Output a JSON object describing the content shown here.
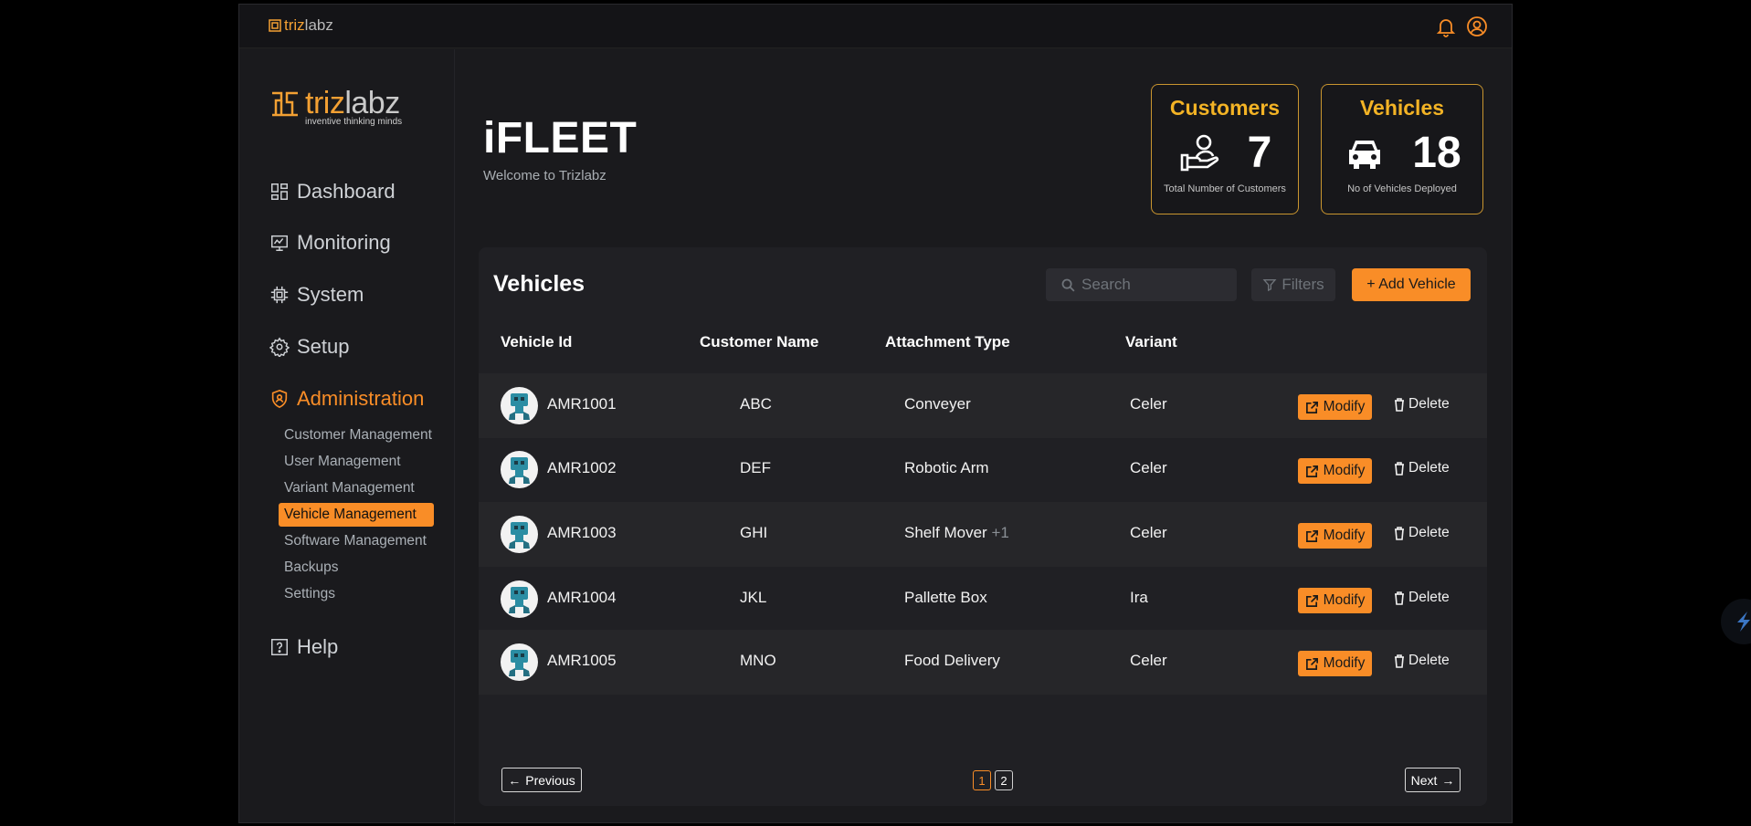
{
  "brand": {
    "part1": "triz",
    "part2": "labz",
    "tagline": "inventive thinking minds",
    "accent_color": "#f98d27"
  },
  "header": {
    "bell_icon": "bell-icon",
    "profile_icon": "user-circle-icon"
  },
  "sidebar": {
    "nav": [
      {
        "label": "Dashboard",
        "icon": "grid-icon"
      },
      {
        "label": "Monitoring",
        "icon": "monitor-icon"
      },
      {
        "label": "System",
        "icon": "chip-icon"
      },
      {
        "label": "Setup",
        "icon": "gear-icon"
      },
      {
        "label": "Administration",
        "icon": "shield-user-icon"
      }
    ],
    "admin_sub": [
      "Customer Management",
      "User Management",
      "Variant Management",
      "Vehicle Management",
      "Software Management",
      "Backups",
      "Settings"
    ],
    "help": {
      "label": "Help",
      "icon": "help-icon"
    }
  },
  "page": {
    "title": "iFLEET",
    "subtitle": "Welcome to Trizlabz"
  },
  "stats": {
    "customers": {
      "title": "Customers",
      "value": "7",
      "caption": "Total Number of Customers"
    },
    "vehicles": {
      "title": "Vehicles",
      "value": "18",
      "caption": "No of Vehicles Deployed"
    }
  },
  "panel": {
    "title": "Vehicles",
    "search_placeholder": "Search",
    "filters_label": "Filters",
    "add_label": "+ Add Vehicle",
    "columns": [
      "Vehicle Id",
      "Customer Name",
      "Attachment Type",
      "Variant"
    ],
    "modify_label": "Modify",
    "delete_label": "Delete",
    "rows": [
      {
        "id": "AMR1001",
        "customer": "ABC",
        "attachment": "Conveyer",
        "extra": "",
        "variant": "Celer"
      },
      {
        "id": "AMR1002",
        "customer": "DEF",
        "attachment": "Robotic Arm",
        "extra": "",
        "variant": "Celer"
      },
      {
        "id": "AMR1003",
        "customer": "GHI",
        "attachment": "Shelf Mover",
        "extra": "+1",
        "variant": "Celer"
      },
      {
        "id": "AMR1004",
        "customer": "JKL",
        "attachment": "Pallette Box",
        "extra": "",
        "variant": "Ira"
      },
      {
        "id": "AMR1005",
        "customer": "MNO",
        "attachment": "Food Delivery",
        "extra": "",
        "variant": "Celer"
      }
    ],
    "pagination": {
      "prev": "Previous",
      "next": "Next",
      "pages": [
        "1",
        "2"
      ]
    }
  }
}
